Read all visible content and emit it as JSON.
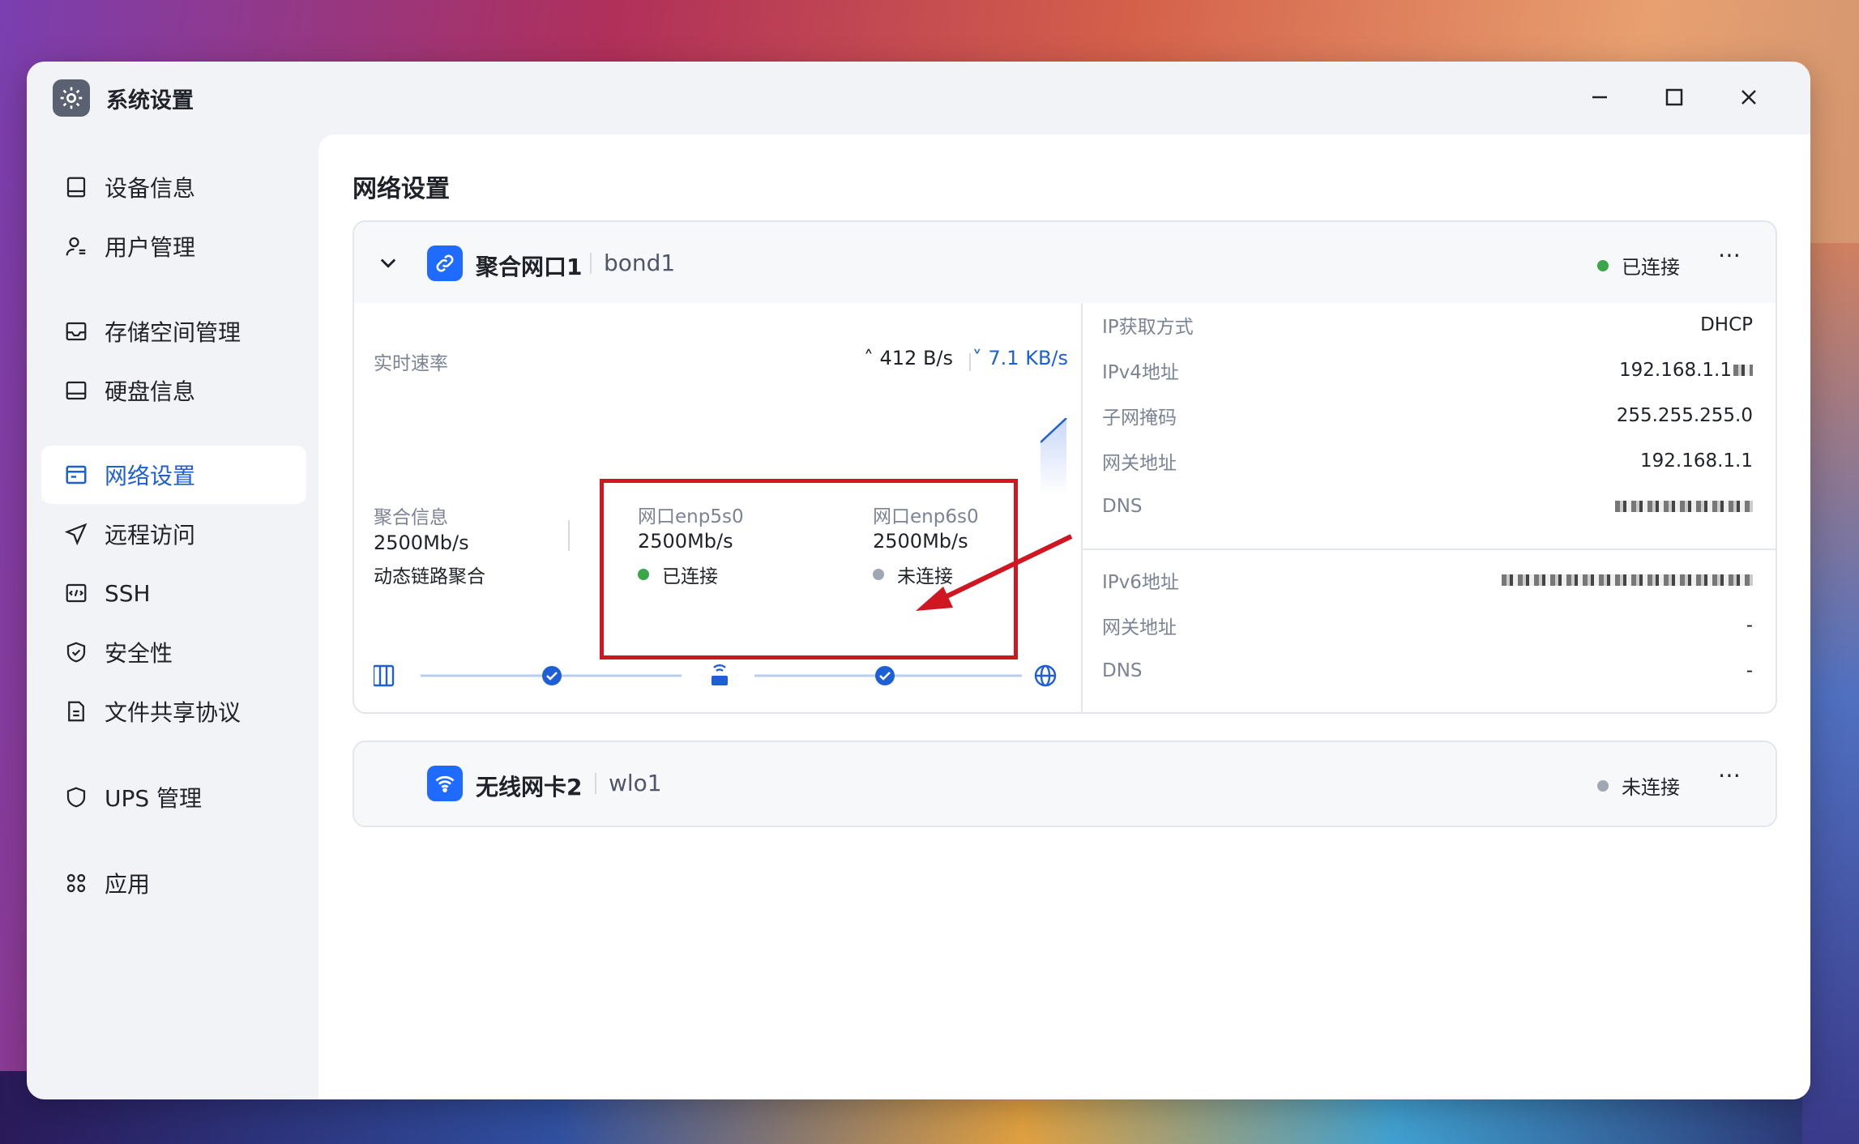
{
  "window": {
    "title": "系统设置"
  },
  "sidebar": {
    "items": [
      {
        "label": "设备信息",
        "icon": "device-icon"
      },
      {
        "label": "用户管理",
        "icon": "user-icon"
      },
      {
        "label": "存储空间管理",
        "icon": "storage-icon"
      },
      {
        "label": "硬盘信息",
        "icon": "disk-icon"
      },
      {
        "label": "网络设置",
        "icon": "network-icon",
        "active": true
      },
      {
        "label": "远程访问",
        "icon": "send-icon"
      },
      {
        "label": "SSH",
        "icon": "code-icon"
      },
      {
        "label": "安全性",
        "icon": "shield-check-icon"
      },
      {
        "label": "文件共享协议",
        "icon": "file-icon"
      },
      {
        "label": "UPS 管理",
        "icon": "shield-icon"
      },
      {
        "label": "应用",
        "icon": "apps-icon"
      }
    ]
  },
  "main": {
    "title": "网络设置",
    "bond": {
      "name": "聚合网口1",
      "device": "bond1",
      "status": "已连接",
      "realtime_label": "实时速率",
      "upload_speed": "412 B/s",
      "download_speed": "7.1 KB/s",
      "aggregate_label": "聚合信息",
      "aggregate_speed": "2500Mb/s",
      "aggregate_mode": "动态链路聚合",
      "ports": [
        {
          "name": "网口enp5s0",
          "speed": "2500Mb/s",
          "status": "已连接"
        },
        {
          "name": "网口enp6s0",
          "speed": "2500Mb/s",
          "status": "未连接"
        }
      ],
      "ipv4": [
        {
          "key": "IP获取方式",
          "value": "DHCP"
        },
        {
          "key": "IPv4地址",
          "value": "192.168.1.1"
        },
        {
          "key": "子网掩码",
          "value": "255.255.255.0"
        },
        {
          "key": "网关地址",
          "value": "192.168.1.1"
        },
        {
          "key": "DNS",
          "value": ""
        }
      ],
      "ipv6": [
        {
          "key": "IPv6地址",
          "value": ""
        },
        {
          "key": "网关地址",
          "value": "-"
        },
        {
          "key": "DNS",
          "value": "-"
        }
      ]
    },
    "wifi": {
      "name": "无线网卡2",
      "device": "wlo1",
      "status": "未连接"
    }
  },
  "colors": {
    "accent": "#1f5fd6",
    "connected": "#3aa64a",
    "disconnected": "#a0a7b4",
    "annotation": "#d01620"
  }
}
